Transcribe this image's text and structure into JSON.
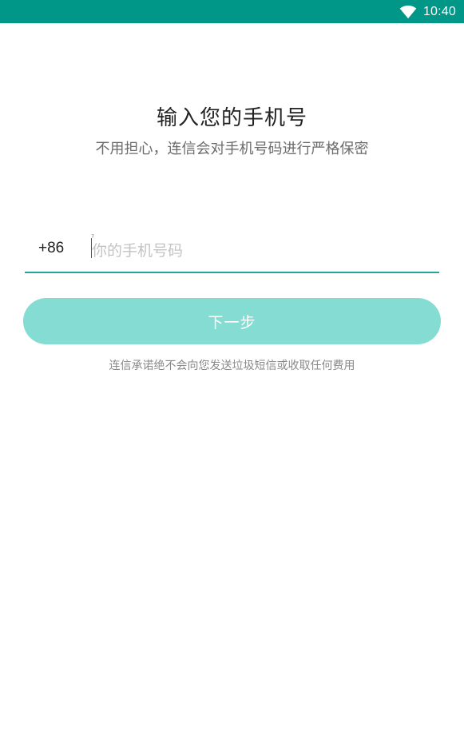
{
  "status_bar": {
    "time": "10:40",
    "wifi_icon": "wifi-icon",
    "background": "#009688"
  },
  "header": {
    "title": "输入您的手机号",
    "subtitle": "不用担心，连信会对手机号码进行严格保密"
  },
  "phone": {
    "country_code": "+86",
    "placeholder": "你的手机号码",
    "value": "",
    "underline_color": "#26a69a"
  },
  "actions": {
    "next_label": "下一步",
    "next_color": "#84dcd3"
  },
  "footer": {
    "notice": "连信承诺绝不会向您发送垃圾短信或收取任何费用"
  }
}
